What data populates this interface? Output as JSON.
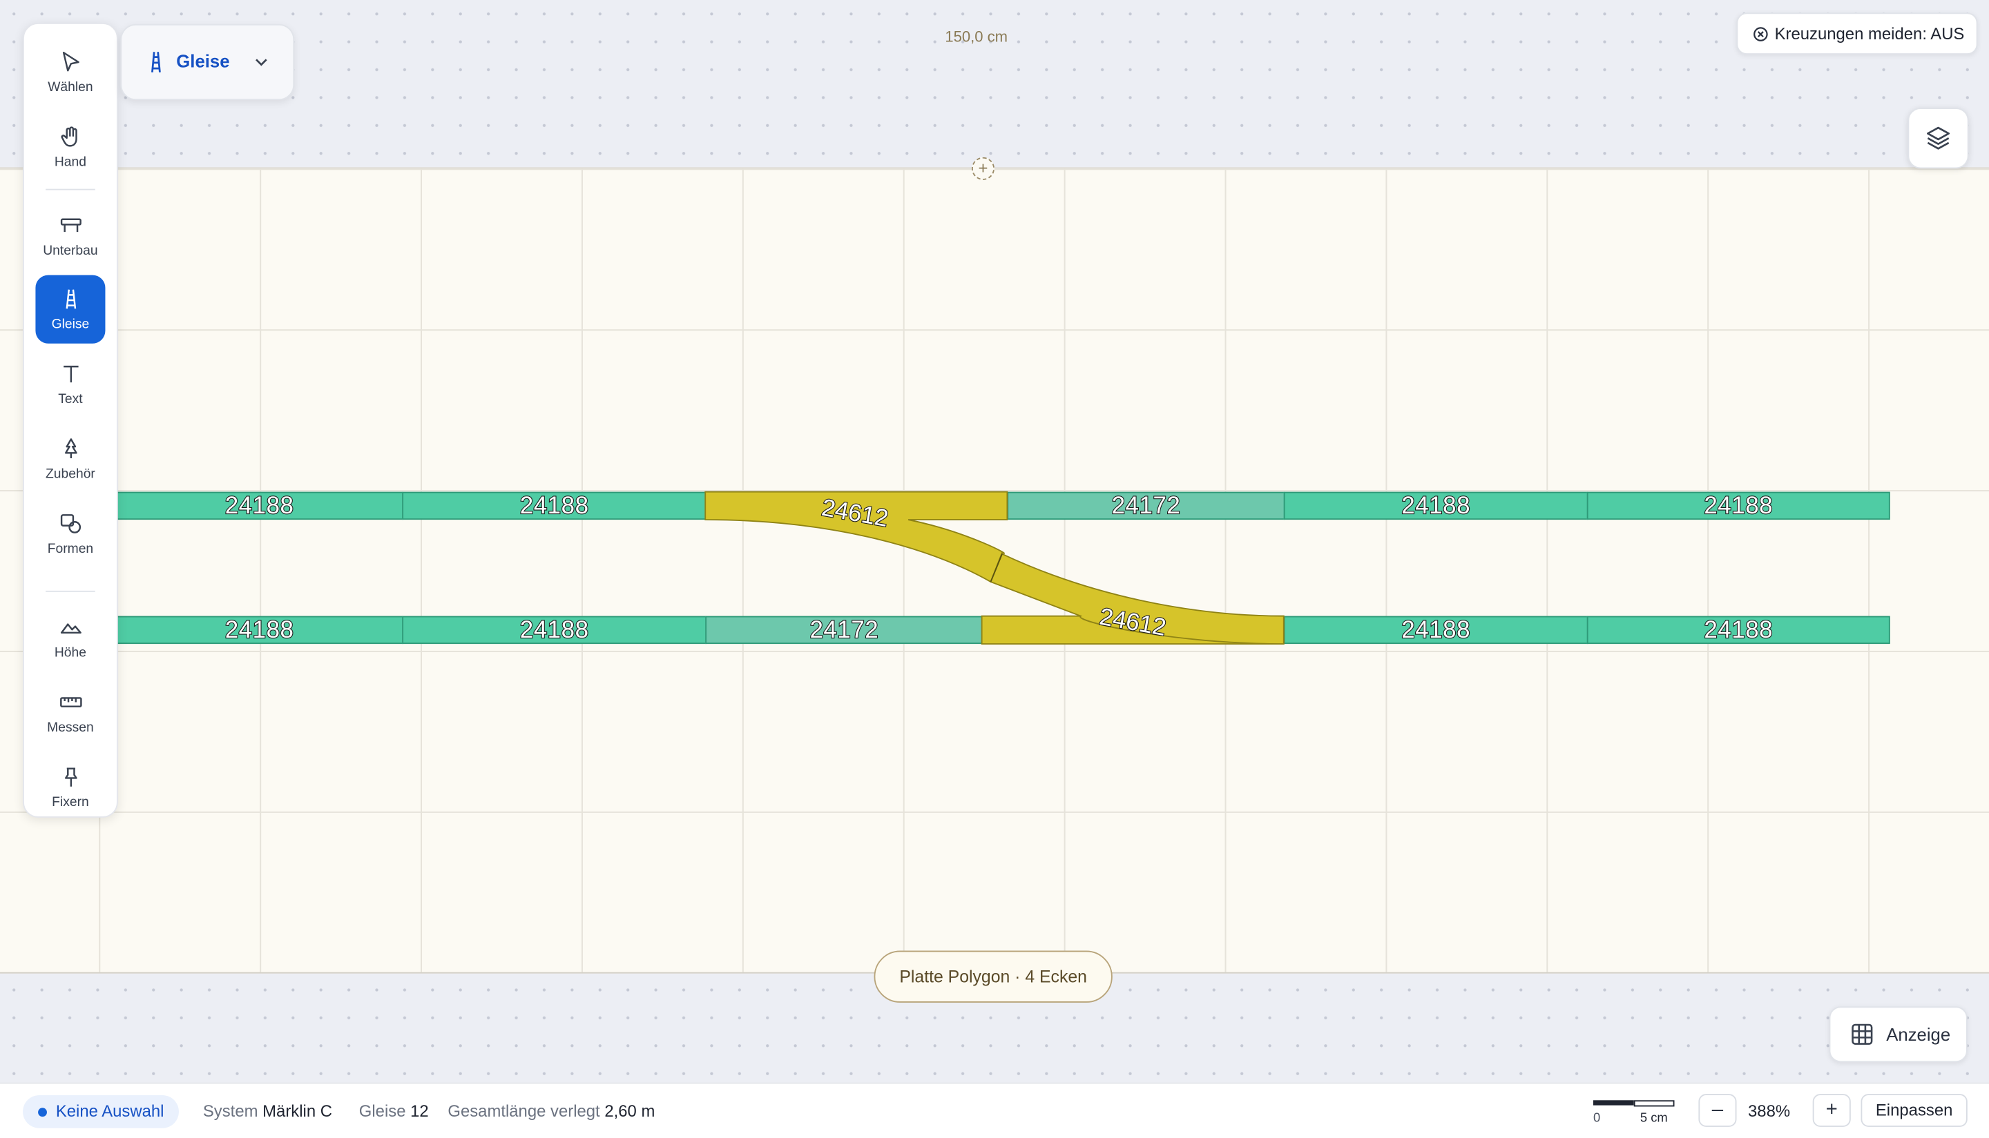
{
  "canvas": {
    "dimension_label": "150,0 cm",
    "board_pill": "Platte Polygon · 4 Ecken"
  },
  "toolbar": {
    "items": [
      {
        "label": "Wählen",
        "icon": "cursor-icon"
      },
      {
        "label": "Hand",
        "icon": "hand-icon"
      },
      {
        "label": "Unterbau",
        "icon": "table-icon"
      },
      {
        "label": "Gleise",
        "icon": "track-icon",
        "active": true
      },
      {
        "label": "Text",
        "icon": "text-icon"
      },
      {
        "label": "Zubehör",
        "icon": "tree-icon"
      },
      {
        "label": "Formen",
        "icon": "shapes-icon"
      },
      {
        "label": "Höhe",
        "icon": "mountain-icon"
      },
      {
        "label": "Messen",
        "icon": "ruler-icon"
      },
      {
        "label": "Fixern",
        "icon": "pin-icon"
      }
    ]
  },
  "mode_dropdown": {
    "label": "Gleise"
  },
  "top_right": {
    "crossing_toggle": "Kreuzungen meiden: AUS"
  },
  "tracks": {
    "top_row": [
      "24188",
      "24188",
      "24612",
      "24172",
      "24188",
      "24188"
    ],
    "bottom_row": [
      "24188",
      "24188",
      "24172",
      "24612",
      "24188",
      "24188"
    ],
    "switch_label": "24612",
    "colors": {
      "straight": "#4fcca4",
      "short": "#6dc8ac",
      "switch": "#d6c42a"
    }
  },
  "display_button": "Anzeige",
  "status": {
    "selection": "Keine Auswahl",
    "system_label": "System",
    "system_value": "Märklin C",
    "tracks_label": "Gleise",
    "tracks_value": "12",
    "length_label": "Gesamtlänge verlegt",
    "length_value": "2,60 m",
    "scale_zero": "0",
    "scale_len": "5 cm",
    "zoom": "388%",
    "zoom_out": "–",
    "zoom_in": "+",
    "fit": "Einpassen"
  }
}
